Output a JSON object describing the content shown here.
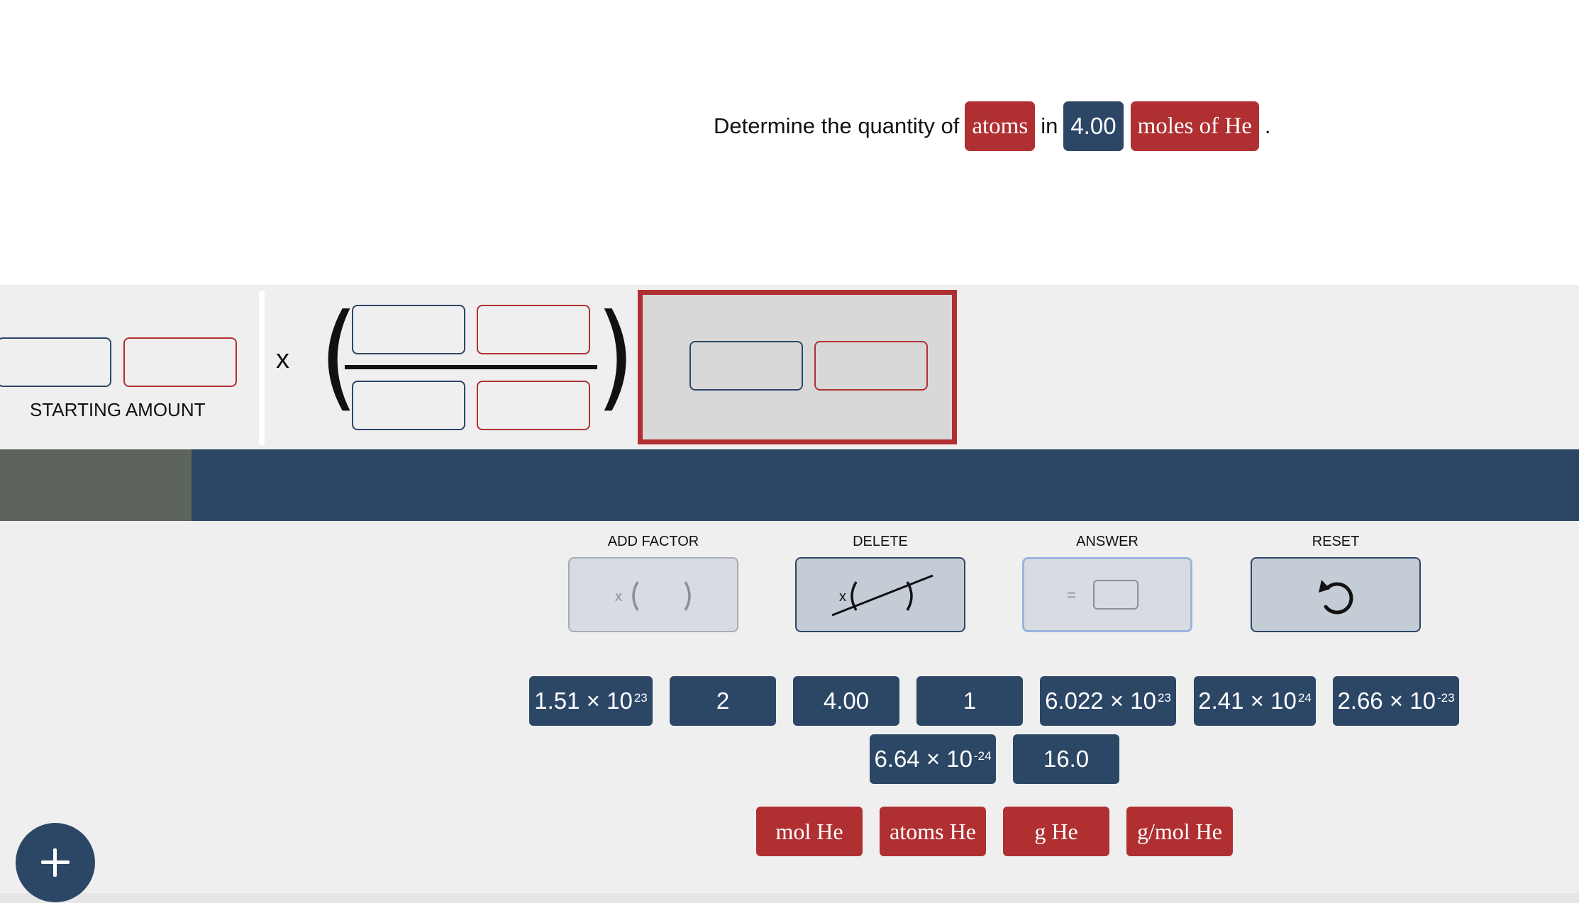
{
  "question": {
    "prefix": "Determine the quantity of",
    "target": "atoms",
    "connector": "in",
    "amount": "4.00",
    "given_unit": "moles of He",
    "suffix": "."
  },
  "equation": {
    "starting_label": "STARTING AMOUNT",
    "times_symbol": "x",
    "open_paren": "(",
    "close_paren": ")"
  },
  "tools": {
    "add_factor_label": "ADD FACTOR",
    "delete_label": "DELETE",
    "answer_label": "ANSWER",
    "reset_label": "RESET",
    "add_factor_icon_text": "x",
    "delete_icon_text": "x",
    "answer_icon_text": "="
  },
  "number_tiles": [
    {
      "mantissa": "1.51 × 10",
      "exp": "23"
    },
    {
      "mantissa": "2",
      "exp": ""
    },
    {
      "mantissa": "4.00",
      "exp": ""
    },
    {
      "mantissa": "1",
      "exp": ""
    },
    {
      "mantissa": "6.022 × 10",
      "exp": "23"
    },
    {
      "mantissa": "2.41 × 10",
      "exp": "24"
    },
    {
      "mantissa": "2.66 × 10",
      "exp": "-23"
    },
    {
      "mantissa": "6.64 × 10",
      "exp": "-24"
    },
    {
      "mantissa": "16.0",
      "exp": ""
    }
  ],
  "unit_tiles": [
    "mol He",
    "atoms He",
    "g He",
    "g/mol He"
  ],
  "colors": {
    "navy": "#2c4766",
    "red": "#b03032",
    "panel": "#efefef",
    "answer_bg": "#d8d8d8",
    "olive": "#5c645c"
  },
  "icons": {
    "fab": "plus-icon",
    "reset": "undo-icon"
  }
}
